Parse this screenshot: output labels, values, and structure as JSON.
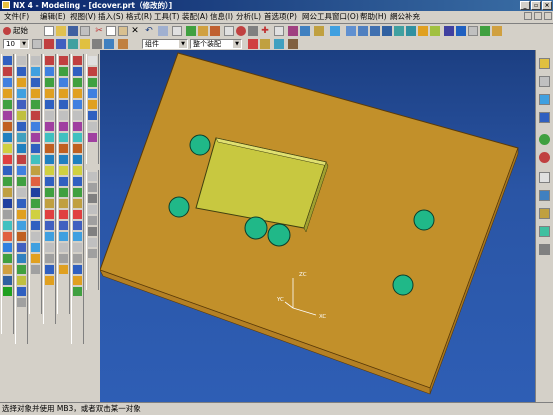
{
  "window": {
    "title": "NX 4 - Modeling - [dcover.prt（修改的）]",
    "controls": [
      "_",
      "▫",
      "×"
    ]
  },
  "menubar": {
    "items": [
      "文件(F)",
      "编辑(E)",
      "视图(V)",
      "插入(S)",
      "格式(R)",
      "工具(T)",
      "装配(A)",
      "信息(I)",
      "分析(L)",
      "首选项(P)",
      "网公工具",
      "窗口(O)",
      "帮助(H)",
      "網公补充"
    ]
  },
  "toolbar": {
    "start_label": "起始",
    "layer_value": "10",
    "filter_value": "组件",
    "scope_value": "整个装配"
  },
  "viewport": {
    "background": "#2a55a5",
    "plate_color": "#d4a034",
    "pocket_color": "#c8c840",
    "hole_color": "#20c08a",
    "axis_labels": {
      "x": "XC",
      "y": "YC",
      "z": "ZC"
    }
  },
  "statusbar": {
    "message": "选择对象并使用 MB3，或者双击某一对象"
  }
}
